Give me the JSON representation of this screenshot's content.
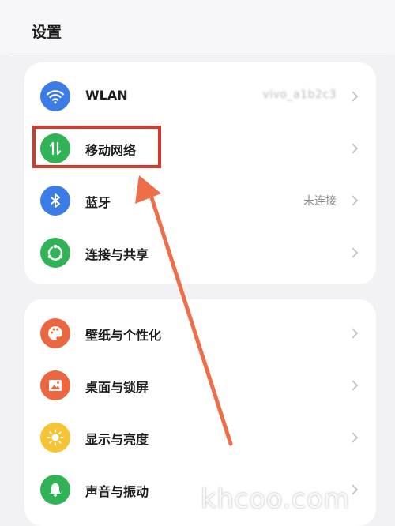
{
  "header": {
    "title": "设置"
  },
  "group1": [
    {
      "label": "WLAN",
      "value": "vivo_a1b2c3",
      "icon": "wifi-icon",
      "color": "#3b7ce8"
    },
    {
      "label": "移动网络",
      "value": "",
      "icon": "mobile-data-icon",
      "color": "#2fb356"
    },
    {
      "label": "蓝牙",
      "value": "未连接",
      "icon": "bluetooth-icon",
      "color": "#3b7ce8"
    },
    {
      "label": "连接与共享",
      "value": "",
      "icon": "share-icon",
      "color": "#2fb356"
    }
  ],
  "group2": [
    {
      "label": "壁纸与个性化",
      "icon": "palette-icon",
      "color": "#ec6640"
    },
    {
      "label": "桌面与锁屏",
      "icon": "image-icon",
      "color": "#ec6640"
    },
    {
      "label": "显示与亮度",
      "icon": "sun-icon",
      "color": "#f6c433"
    },
    {
      "label": "声音与振动",
      "icon": "bell-icon",
      "color": "#2fb356"
    }
  ],
  "watermark": "khcoo.com",
  "colors": {
    "highlight": "#d4392b",
    "arrow": "#ee6e4a"
  }
}
